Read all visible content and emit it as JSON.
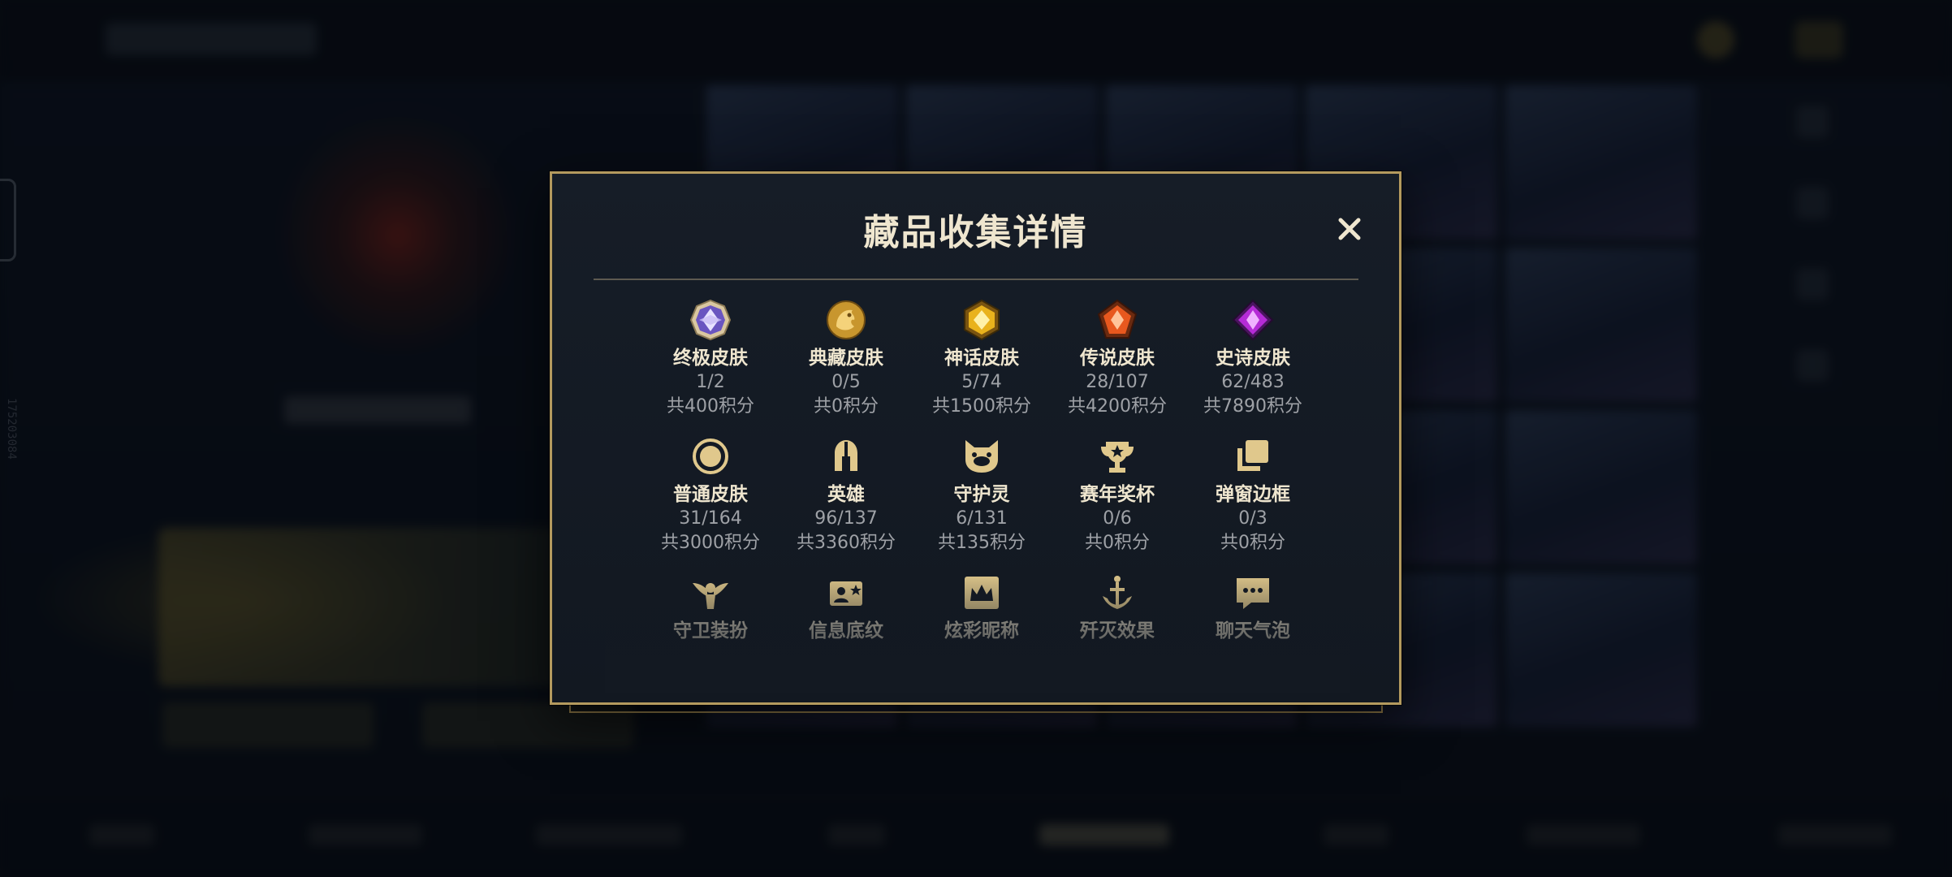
{
  "background": {
    "side_code": "175203084"
  },
  "modal": {
    "title": "藏品收集详情",
    "close_symbol": "✕",
    "items": [
      {
        "icon": "ultimate-skin-icon",
        "name": "终极皮肤",
        "count": "1/2",
        "points": "共400积分"
      },
      {
        "icon": "collector-skin-icon",
        "name": "典藏皮肤",
        "count": "0/5",
        "points": "共0积分"
      },
      {
        "icon": "mythic-skin-icon",
        "name": "神话皮肤",
        "count": "5/74",
        "points": "共1500积分"
      },
      {
        "icon": "legendary-skin-icon",
        "name": "传说皮肤",
        "count": "28/107",
        "points": "共4200积分"
      },
      {
        "icon": "epic-skin-icon",
        "name": "史诗皮肤",
        "count": "62/483",
        "points": "共7890积分"
      },
      {
        "icon": "normal-skin-icon",
        "name": "普通皮肤",
        "count": "31/164",
        "points": "共3000积分"
      },
      {
        "icon": "champion-helmet-icon",
        "name": "英雄",
        "count": "96/137",
        "points": "共3360积分"
      },
      {
        "icon": "guardian-spirit-icon",
        "name": "守护灵",
        "count": "6/131",
        "points": "共135积分"
      },
      {
        "icon": "season-trophy-icon",
        "name": "赛年奖杯",
        "count": "0/6",
        "points": "共0积分"
      },
      {
        "icon": "popup-frame-icon",
        "name": "弹窗边框",
        "count": "0/3",
        "points": "共0积分"
      },
      {
        "icon": "guardian-outfit-icon",
        "name": "守卫装扮",
        "count": "",
        "points": ""
      },
      {
        "icon": "info-card-icon",
        "name": "信息底纹",
        "count": "",
        "points": ""
      },
      {
        "icon": "nickname-crown-icon",
        "name": "炫彩昵称",
        "count": "",
        "points": ""
      },
      {
        "icon": "annihilation-effect-icon",
        "name": "歼灭效果",
        "count": "",
        "points": ""
      },
      {
        "icon": "chat-bubble-icon",
        "name": "聊天气泡",
        "count": "",
        "points": ""
      }
    ]
  },
  "colors": {
    "gold_border": "#b49a5e",
    "title_text": "#efe6cf",
    "muted_text": "#9ea1a6",
    "icon_gold": "#e0c88c"
  }
}
